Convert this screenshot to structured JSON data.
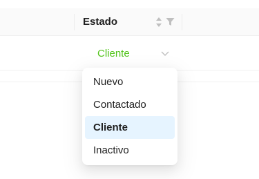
{
  "table": {
    "column_title": "Estado",
    "row_status": "Cliente",
    "status_color": "#52c41a"
  },
  "dropdown": {
    "selected": "Cliente",
    "options": [
      {
        "label": "Nuevo"
      },
      {
        "label": "Contactado"
      },
      {
        "label": "Cliente"
      },
      {
        "label": "Inactivo"
      }
    ]
  },
  "icons": {
    "sort": "sort-icon",
    "filter": "filter-icon",
    "chevron": "chevron-down-icon"
  }
}
